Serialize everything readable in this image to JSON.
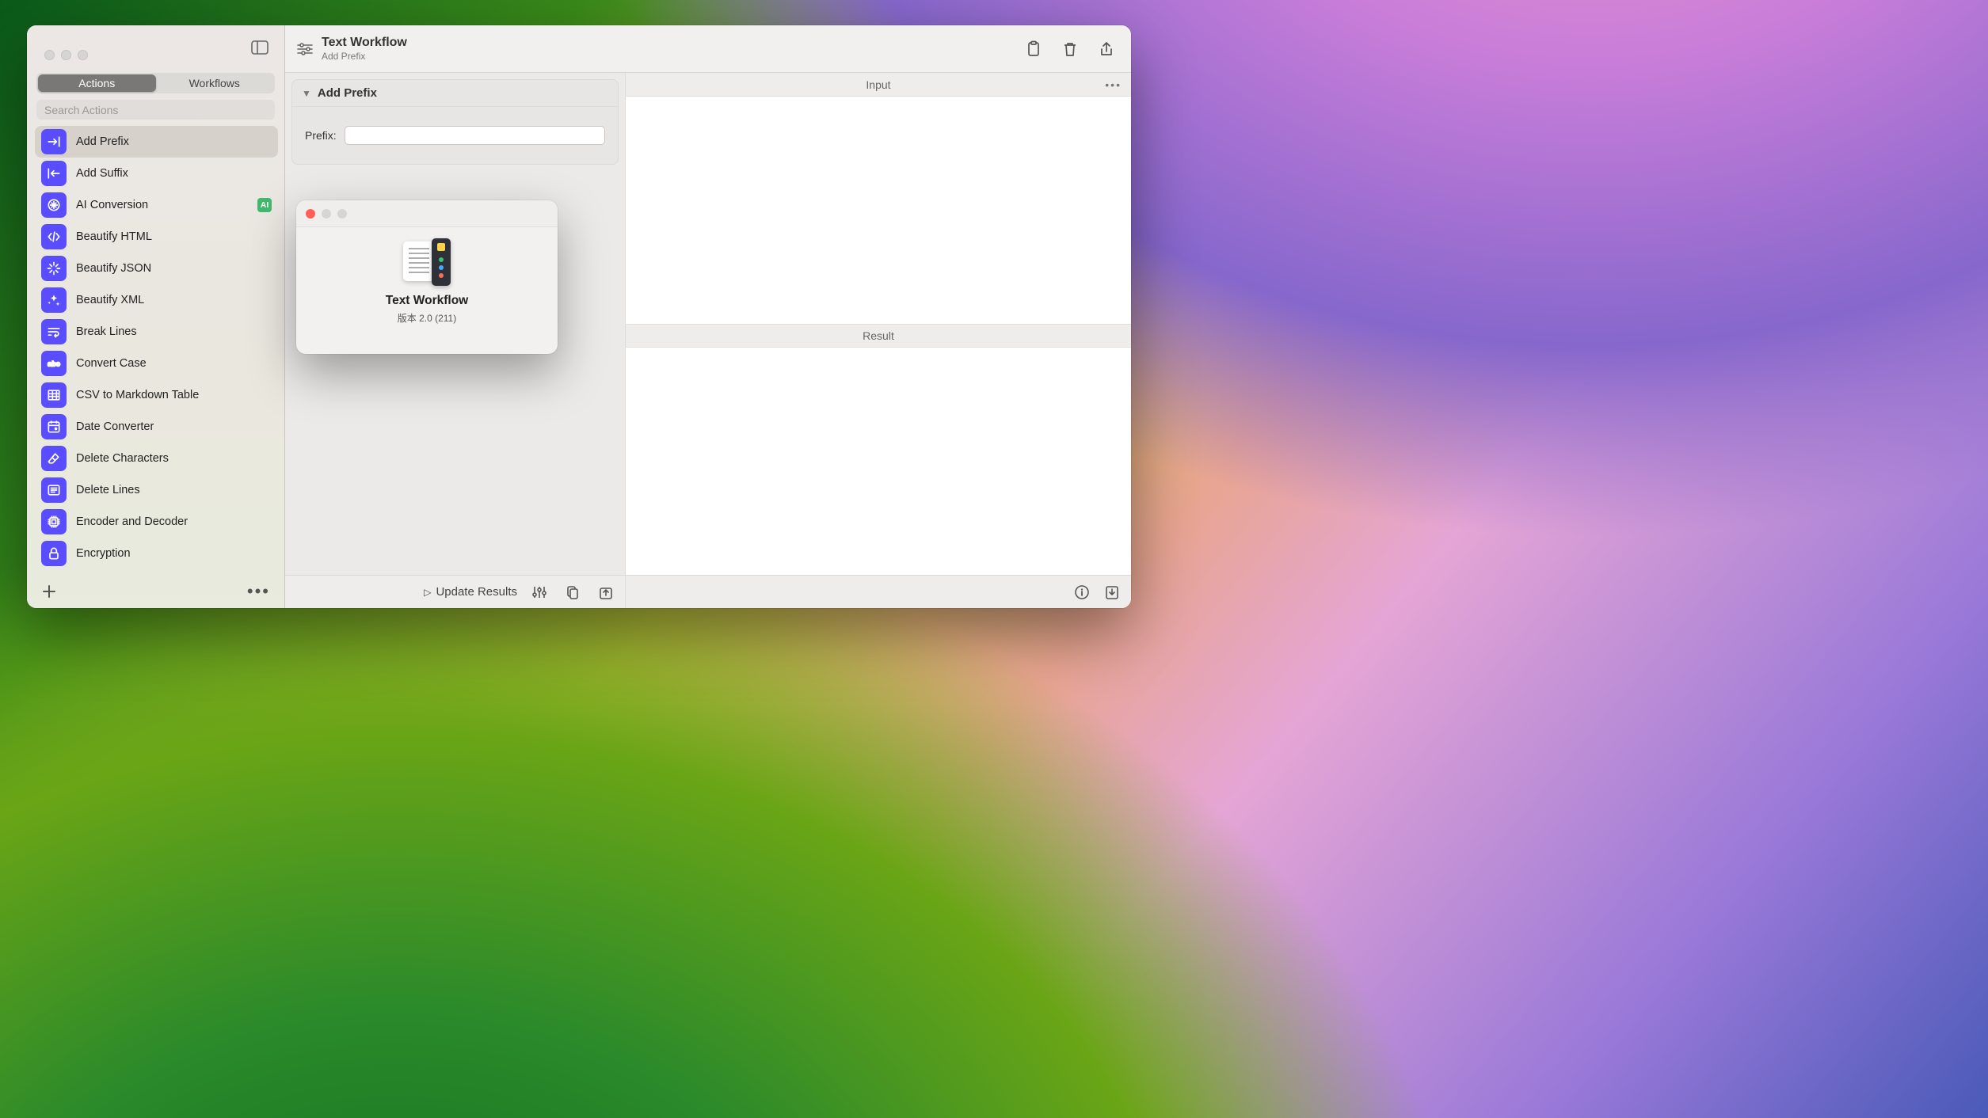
{
  "app": {
    "title": "Text Workflow",
    "subtitle": "Add Prefix"
  },
  "sidebar": {
    "tabs": {
      "actions": "Actions",
      "workflows": "Workflows"
    },
    "search_placeholder": "Search Actions",
    "items": [
      {
        "label": "Add Prefix",
        "icon": "arrow-right-bar",
        "selected": true
      },
      {
        "label": "Add Suffix",
        "icon": "arrow-left-bar"
      },
      {
        "label": "AI Conversion",
        "icon": "ai-spark",
        "badge": "AI"
      },
      {
        "label": "Beautify HTML",
        "icon": "code-brackets"
      },
      {
        "label": "Beautify JSON",
        "icon": "burst"
      },
      {
        "label": "Beautify XML",
        "icon": "sparkles"
      },
      {
        "label": "Break Lines",
        "icon": "wrap"
      },
      {
        "label": "Convert Case",
        "icon": "abc"
      },
      {
        "label": "CSV to Markdown Table",
        "icon": "table"
      },
      {
        "label": "Date Converter",
        "icon": "calendar"
      },
      {
        "label": "Delete Characters",
        "icon": "erase"
      },
      {
        "label": "Delete Lines",
        "icon": "lines-x"
      },
      {
        "label": "Encoder and Decoder",
        "icon": "chip"
      },
      {
        "label": "Encryption",
        "icon": "lock"
      }
    ]
  },
  "workflow": {
    "card_title": "Add Prefix",
    "prefix_label": "Prefix:",
    "prefix_value": "",
    "update_label": "Update Results"
  },
  "io": {
    "input_label": "Input",
    "result_label": "Result"
  },
  "about": {
    "name": "Text Workflow",
    "version": "版本 2.0 (211)"
  }
}
